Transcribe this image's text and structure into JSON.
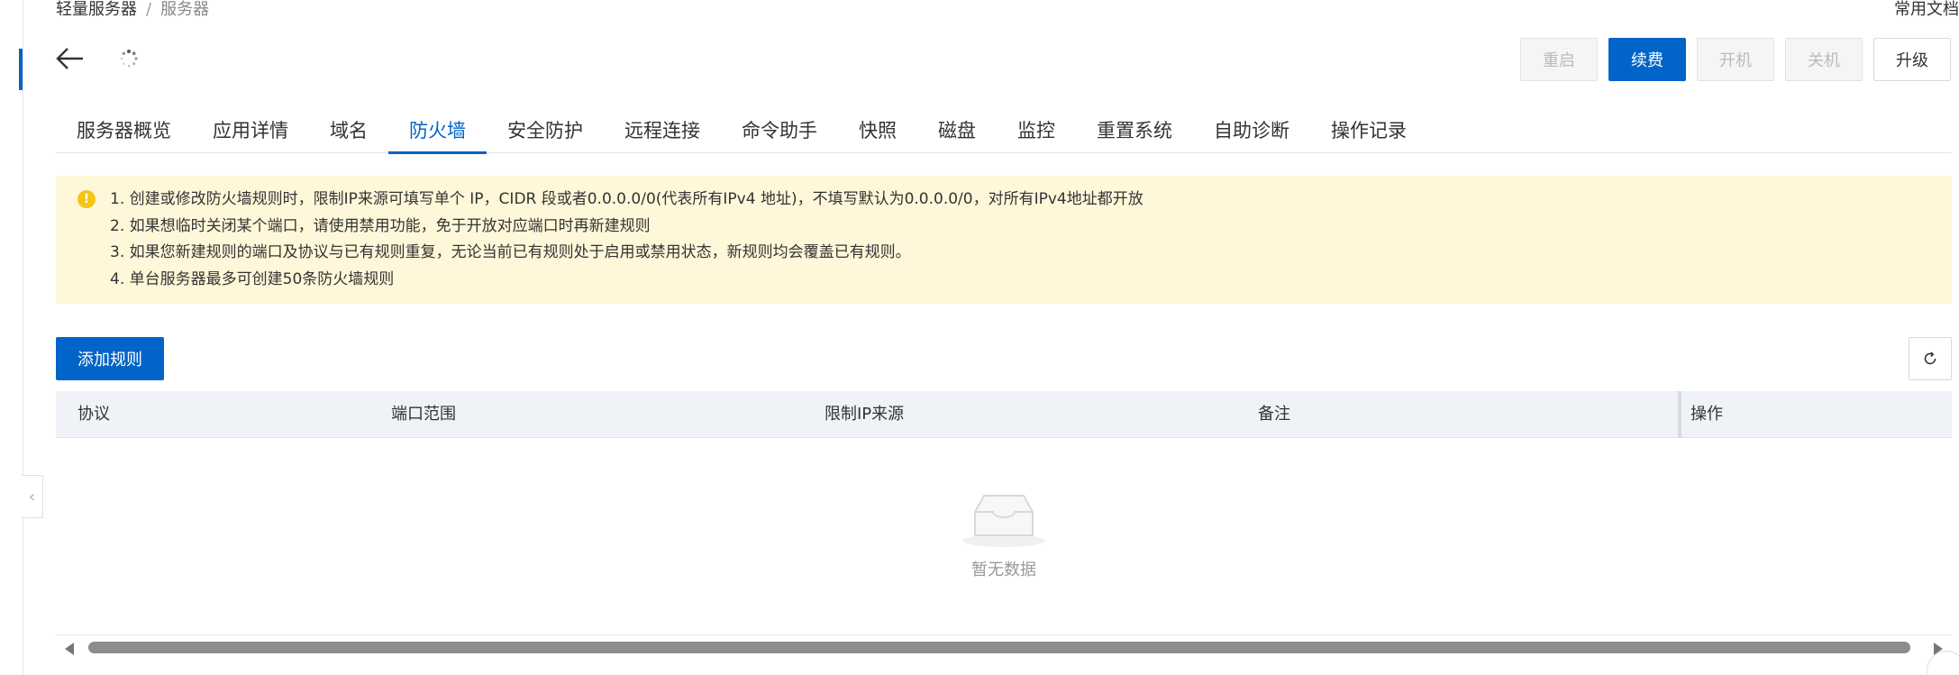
{
  "breadcrumb": {
    "parent": "轻量服务器",
    "separator": "/",
    "current": "服务器"
  },
  "header": {
    "docs_link": "常用文档"
  },
  "icons": {
    "back": "back-arrow-icon",
    "loading": "loading-spinner-icon",
    "warning": "warning-icon",
    "refresh": "refresh-icon",
    "empty": "empty-inbox-icon",
    "collapse": "chevron-left-icon"
  },
  "actions": {
    "restart": "重启",
    "renew": "续费",
    "power_on": "开机",
    "power_off": "关机",
    "upgrade": "升级"
  },
  "tabs": [
    {
      "label": "服务器概览",
      "active": false
    },
    {
      "label": "应用详情",
      "active": false
    },
    {
      "label": "域名",
      "active": false
    },
    {
      "label": "防火墙",
      "active": true
    },
    {
      "label": "安全防护",
      "active": false
    },
    {
      "label": "远程连接",
      "active": false
    },
    {
      "label": "命令助手",
      "active": false
    },
    {
      "label": "快照",
      "active": false
    },
    {
      "label": "磁盘",
      "active": false
    },
    {
      "label": "监控",
      "active": false
    },
    {
      "label": "重置系统",
      "active": false
    },
    {
      "label": "自助诊断",
      "active": false
    },
    {
      "label": "操作记录",
      "active": false
    }
  ],
  "notice": {
    "lines": [
      "1. 创建或修改防火墙规则时，限制IP来源可填写单个 IP，CIDR 段或者0.0.0.0/0(代表所有IPv4 地址)，不填写默认为0.0.0.0/0，对所有IPv4地址都开放",
      "2. 如果想临时关闭某个端口，请使用禁用功能，免于开放对应端口时再新建规则",
      "3. 如果您新建规则的端口及协议与已有规则重复，无论当前已有规则处于启用或禁用状态，新规则均会覆盖已有规则。",
      "4. 单台服务器最多可创建50条防火墙规则"
    ]
  },
  "toolbar": {
    "add_rule": "添加规则"
  },
  "table": {
    "columns": [
      "协议",
      "端口范围",
      "限制IP来源",
      "备注",
      "操作"
    ],
    "empty_text": "暂无数据"
  },
  "colors": {
    "primary": "#0064c8",
    "notice_bg": "#fff7d9",
    "warning": "#f5c518",
    "table_header_bg": "#eff2f6"
  }
}
